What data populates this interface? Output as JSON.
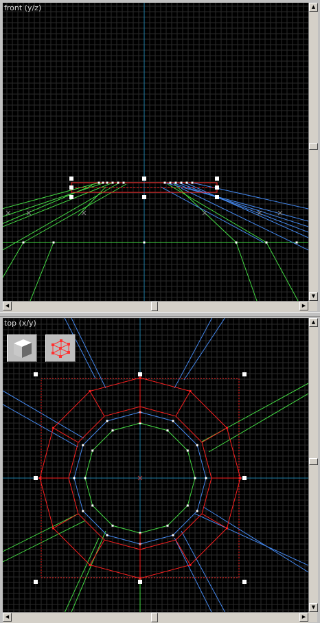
{
  "viewports": {
    "front": {
      "label": "front (y/z)"
    },
    "top": {
      "label": "top (x/y)"
    }
  },
  "tools": [
    {
      "icon": "solid-cube-icon"
    },
    {
      "icon": "wireframe-cube-icon"
    }
  ],
  "colors": {
    "background": "#000000",
    "grid": "#2b2b2b",
    "axis": "#1e7fa8",
    "selection": "#ff2020",
    "green_lines": "#44dd44",
    "blue_lines": "#4488ee",
    "handle": "#ffffff"
  }
}
